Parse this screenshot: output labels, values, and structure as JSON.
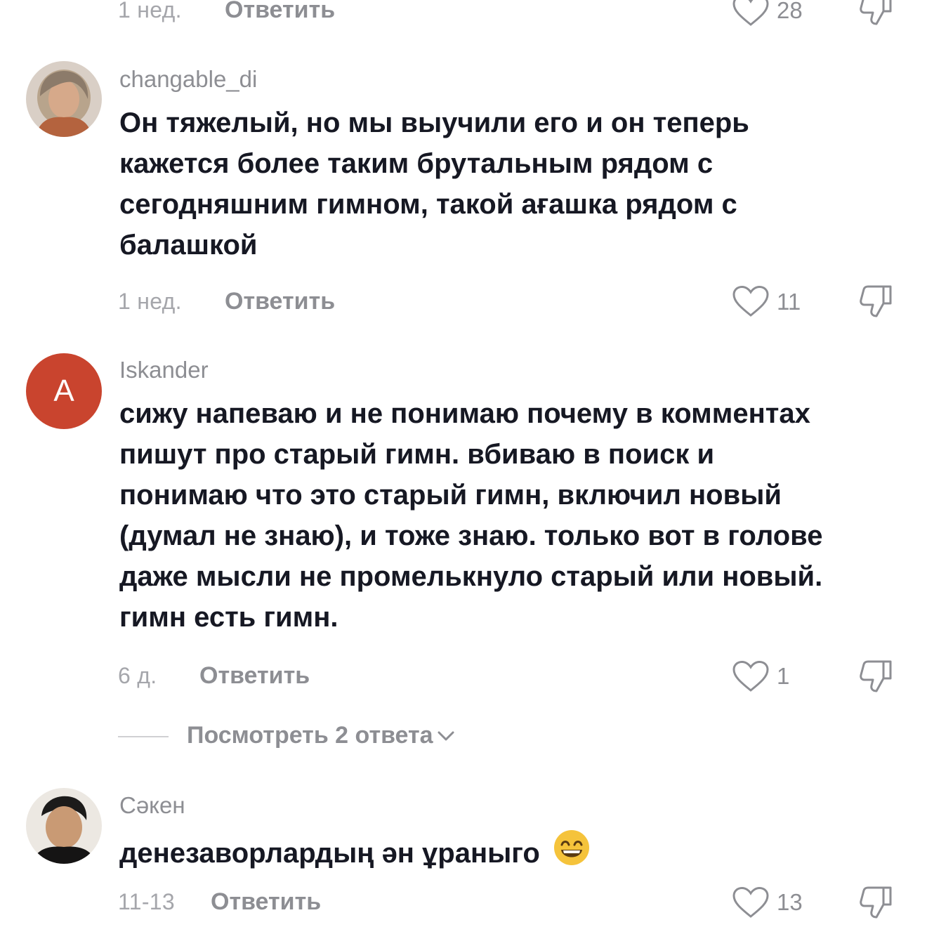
{
  "comments": [
    {
      "time": "1 нед.",
      "reply_label": "Ответить",
      "likes": "28"
    },
    {
      "username": "changable_di",
      "text_lines": [
        "Он тяжелый, но мы выучили его и он теперь",
        "кажется более таким брутальным рядом с",
        "сегодняшним гимном, такой ағашка рядом с",
        "балашкой"
      ],
      "time": "1 нед.",
      "reply_label": "Ответить",
      "likes": "11"
    },
    {
      "username": "Iskander",
      "avatar_letter": "A",
      "avatar_color": "#c9442e",
      "text_lines": [
        "сижу напеваю и не понимаю почему в комментах",
        "пишут про старый гимн. вбиваю в поиск и",
        "понимаю что это старый гимн, включил новый",
        "(думал не знаю), и тоже знаю. только вот в голове",
        "даже мысли не промелькнуло старый или новый.",
        "гимн есть гимн."
      ],
      "time": "6 д.",
      "reply_label": "Ответить",
      "likes": "1",
      "view_replies": "Посмотреть 2 ответа"
    },
    {
      "username": "Сәкен",
      "text": "денезаворлардың ән ұраныго",
      "emoji": "😄",
      "time": "11-13",
      "reply_label": "Ответить",
      "likes": "13"
    }
  ],
  "icons": {
    "like": "heart-outline-icon",
    "dislike": "thumbs-down-outline-icon",
    "expand": "chevron-down-icon"
  },
  "colors": {
    "text": "#161823",
    "secondary": "#8d8e93",
    "time": "#a5a6ab"
  }
}
